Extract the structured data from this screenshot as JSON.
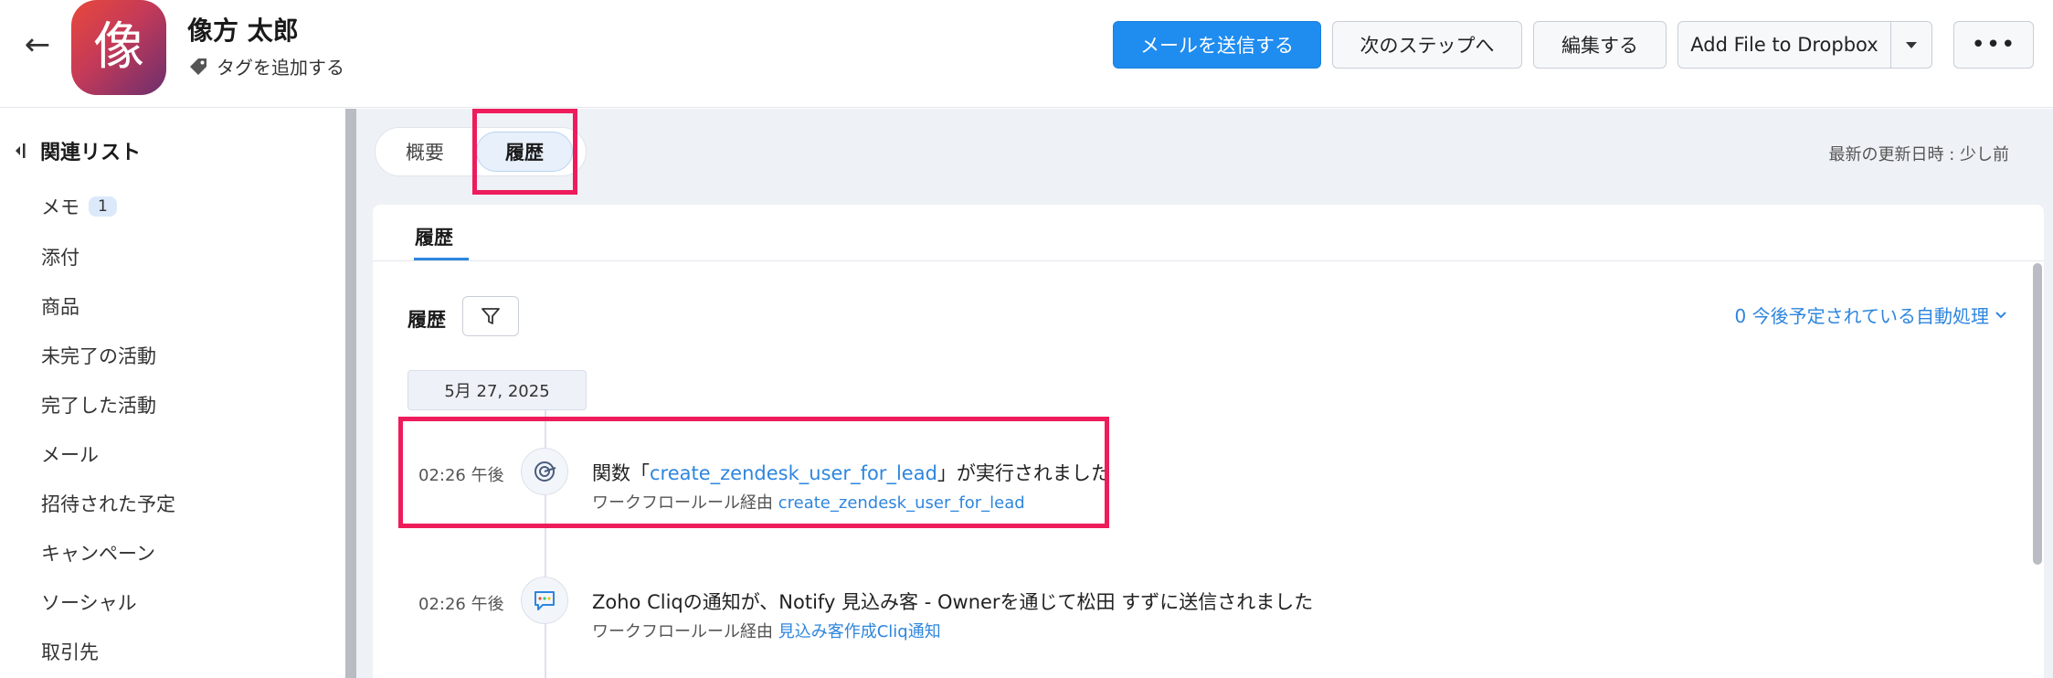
{
  "header": {
    "record_name": "像方 太郎",
    "avatar_char": "像",
    "add_tag": "タグを追加する",
    "buttons": {
      "send_mail": "メールを送信する",
      "next_step": "次のステップへ",
      "edit": "編集する",
      "dropbox": "Add File to Dropbox",
      "more": "•••"
    }
  },
  "sidebar": {
    "title": "関連リスト",
    "items": [
      {
        "label": "メモ",
        "badge": "1"
      },
      {
        "label": "添付"
      },
      {
        "label": "商品"
      },
      {
        "label": "未完了の活動"
      },
      {
        "label": "完了した活動"
      },
      {
        "label": "メール"
      },
      {
        "label": "招待された予定"
      },
      {
        "label": "キャンペーン"
      },
      {
        "label": "ソーシャル"
      },
      {
        "label": "取引先"
      }
    ]
  },
  "main": {
    "tabs": [
      {
        "label": "概要"
      },
      {
        "label": "履歴"
      }
    ],
    "active_tab": "履歴",
    "last_updated": "最新の更新日時 : 少し前",
    "panel_tab": "履歴",
    "history_label": "履歴",
    "scheduled_link": "0 今後予定されている自動処理",
    "date_chip": "5月 27, 2025",
    "entries": [
      {
        "time": "02:26 午後",
        "title_prefix": "関数「",
        "title_link": "create_zendesk_user_for_lead",
        "title_suffix": "」が実行されました",
        "sub_prefix": "ワークフロールール経由 ",
        "sub_link": "create_zendesk_user_for_lead"
      },
      {
        "time": "02:26 午後",
        "title": "Zoho Cliqの通知が、Notify 見込み客 - Ownerを通じて松田 すずに送信されました",
        "sub_prefix": "ワークフロールール経由 ",
        "sub_link": "見込み客作成Cliq通知"
      }
    ]
  },
  "colors": {
    "primary": "#1f8cf0",
    "link": "#2e86de",
    "highlight": "#ee1c5b",
    "background": "#eef1f5"
  }
}
